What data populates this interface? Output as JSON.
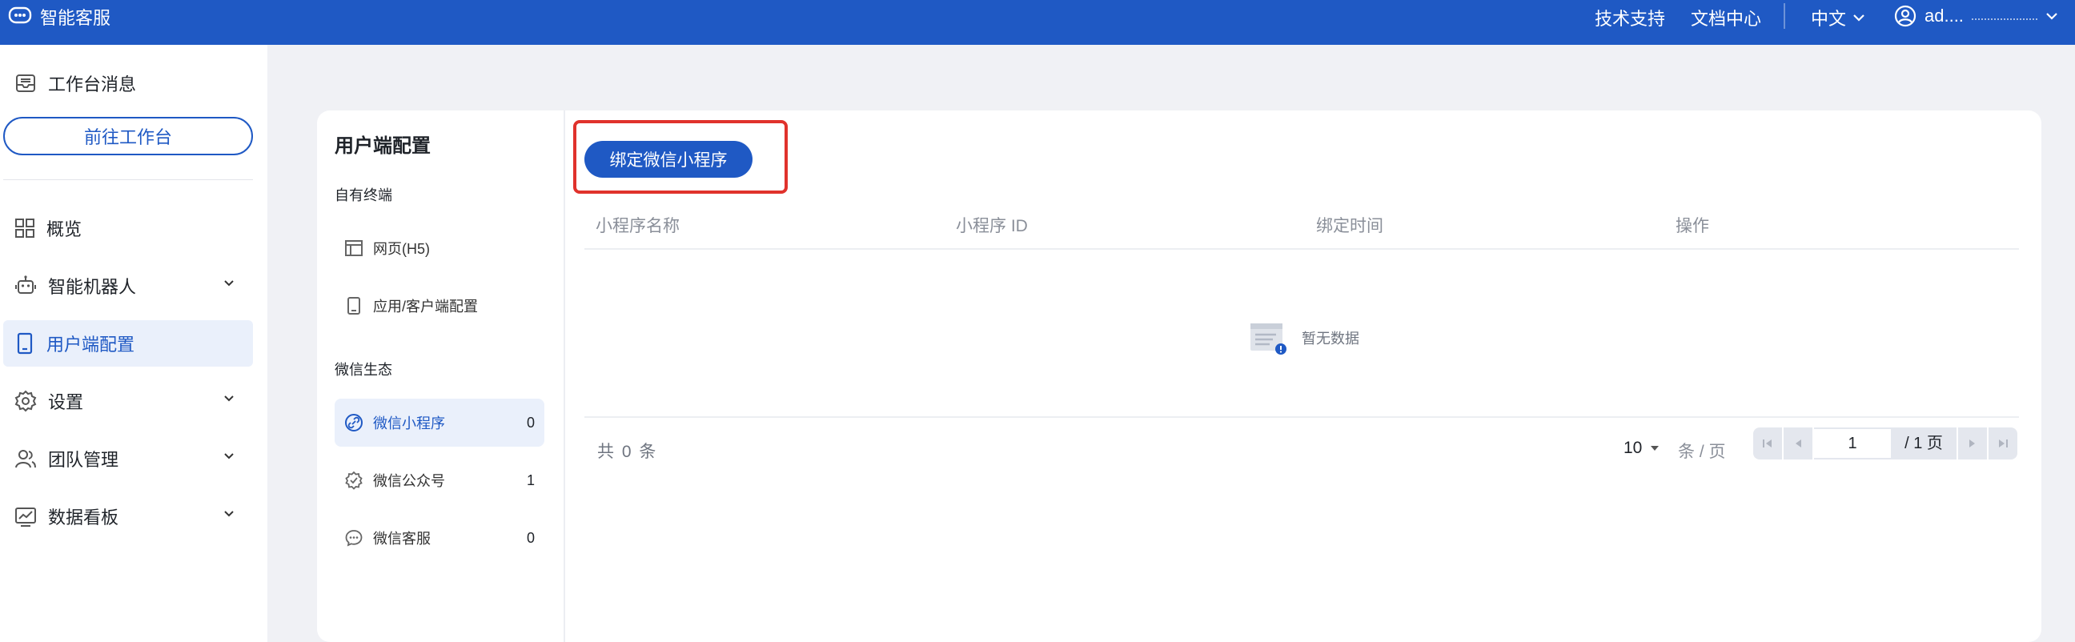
{
  "topbar": {
    "brand": "智能客服",
    "links": [
      "技术支持",
      "文档中心"
    ],
    "language": "中文",
    "user": "ad...."
  },
  "sidebar": {
    "workbench_msg": "工作台消息",
    "goto_button": "前往工作台",
    "items": [
      {
        "label": "概览",
        "icon": "grid-icon"
      },
      {
        "label": "智能机器人",
        "icon": "robot-icon"
      },
      {
        "label": "用户端配置",
        "icon": "tablet-icon"
      },
      {
        "label": "设置",
        "icon": "gear-icon"
      },
      {
        "label": "团队管理",
        "icon": "team-icon"
      },
      {
        "label": "数据看板",
        "icon": "chart-icon"
      }
    ]
  },
  "subnav": {
    "title": "用户端配置",
    "group_own": "自有终端",
    "own_items": [
      {
        "label": "网页(H5)"
      },
      {
        "label": "应用/客户端配置"
      }
    ],
    "group_wechat": "微信生态",
    "wechat_items": [
      {
        "label": "微信小程序",
        "count": "0"
      },
      {
        "label": "微信公众号",
        "count": "1"
      },
      {
        "label": "微信客服",
        "count": "0"
      }
    ]
  },
  "main": {
    "bind_button": "绑定微信小程序",
    "columns": [
      "小程序名称",
      "小程序 ID",
      "绑定时间",
      "操作"
    ],
    "empty_text": "暂无数据",
    "total": "共 0 条",
    "page_size": "10",
    "per_page": "条 / 页",
    "current_page": "1",
    "page_total": "/ 1 页"
  },
  "colors": {
    "primary": "#1f59c4",
    "highlight": "#e0322c",
    "active_bg": "#eaf0fb"
  }
}
